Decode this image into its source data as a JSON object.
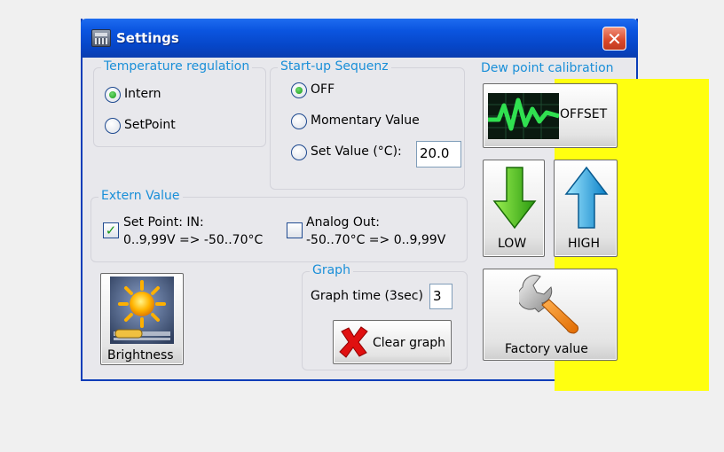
{
  "window": {
    "title": "Settings",
    "close_glyph": "✕"
  },
  "temperature_regulation": {
    "legend": "Temperature regulation",
    "options": [
      {
        "label": "Intern",
        "selected": true
      },
      {
        "label": "SetPoint",
        "selected": false
      }
    ]
  },
  "startup": {
    "legend": "Start-up Sequenz",
    "options": [
      {
        "label": "OFF",
        "selected": true
      },
      {
        "label": "Momentary Value",
        "selected": false
      },
      {
        "label": "Set Value (°C):",
        "selected": false
      }
    ],
    "set_value": "20.0"
  },
  "extern_value": {
    "legend": "Extern Value",
    "set_point": {
      "line1": "Set Point:   IN:",
      "line2": "0..9,99V => -50..70°C",
      "checked": true,
      "check_glyph": "✓"
    },
    "analog_out": {
      "line1": "Analog Out:",
      "line2": "-50..70°C => 0..9,99V",
      "checked": false
    }
  },
  "brightness": {
    "label": "Brightness",
    "icon": "sun-slider-icon"
  },
  "graph": {
    "legend": "Graph",
    "time_label": "Graph time (3sec)",
    "time_value": "3",
    "clear_label": "Clear graph",
    "clear_icon": "red-x-icon"
  },
  "dew_point": {
    "legend": "Dew point calibration",
    "offset_label": "OFFSET",
    "offset_icon": "waveform-icon",
    "low_label": "LOW",
    "high_label": "HIGH",
    "factory_label": "Factory value",
    "factory_icon": "wrench-icon"
  },
  "colors": {
    "title_bar": "#0a55e0",
    "legend_text": "#1a8fd8",
    "dew_highlight": "#ffff10",
    "close_red": "#d8482a"
  }
}
